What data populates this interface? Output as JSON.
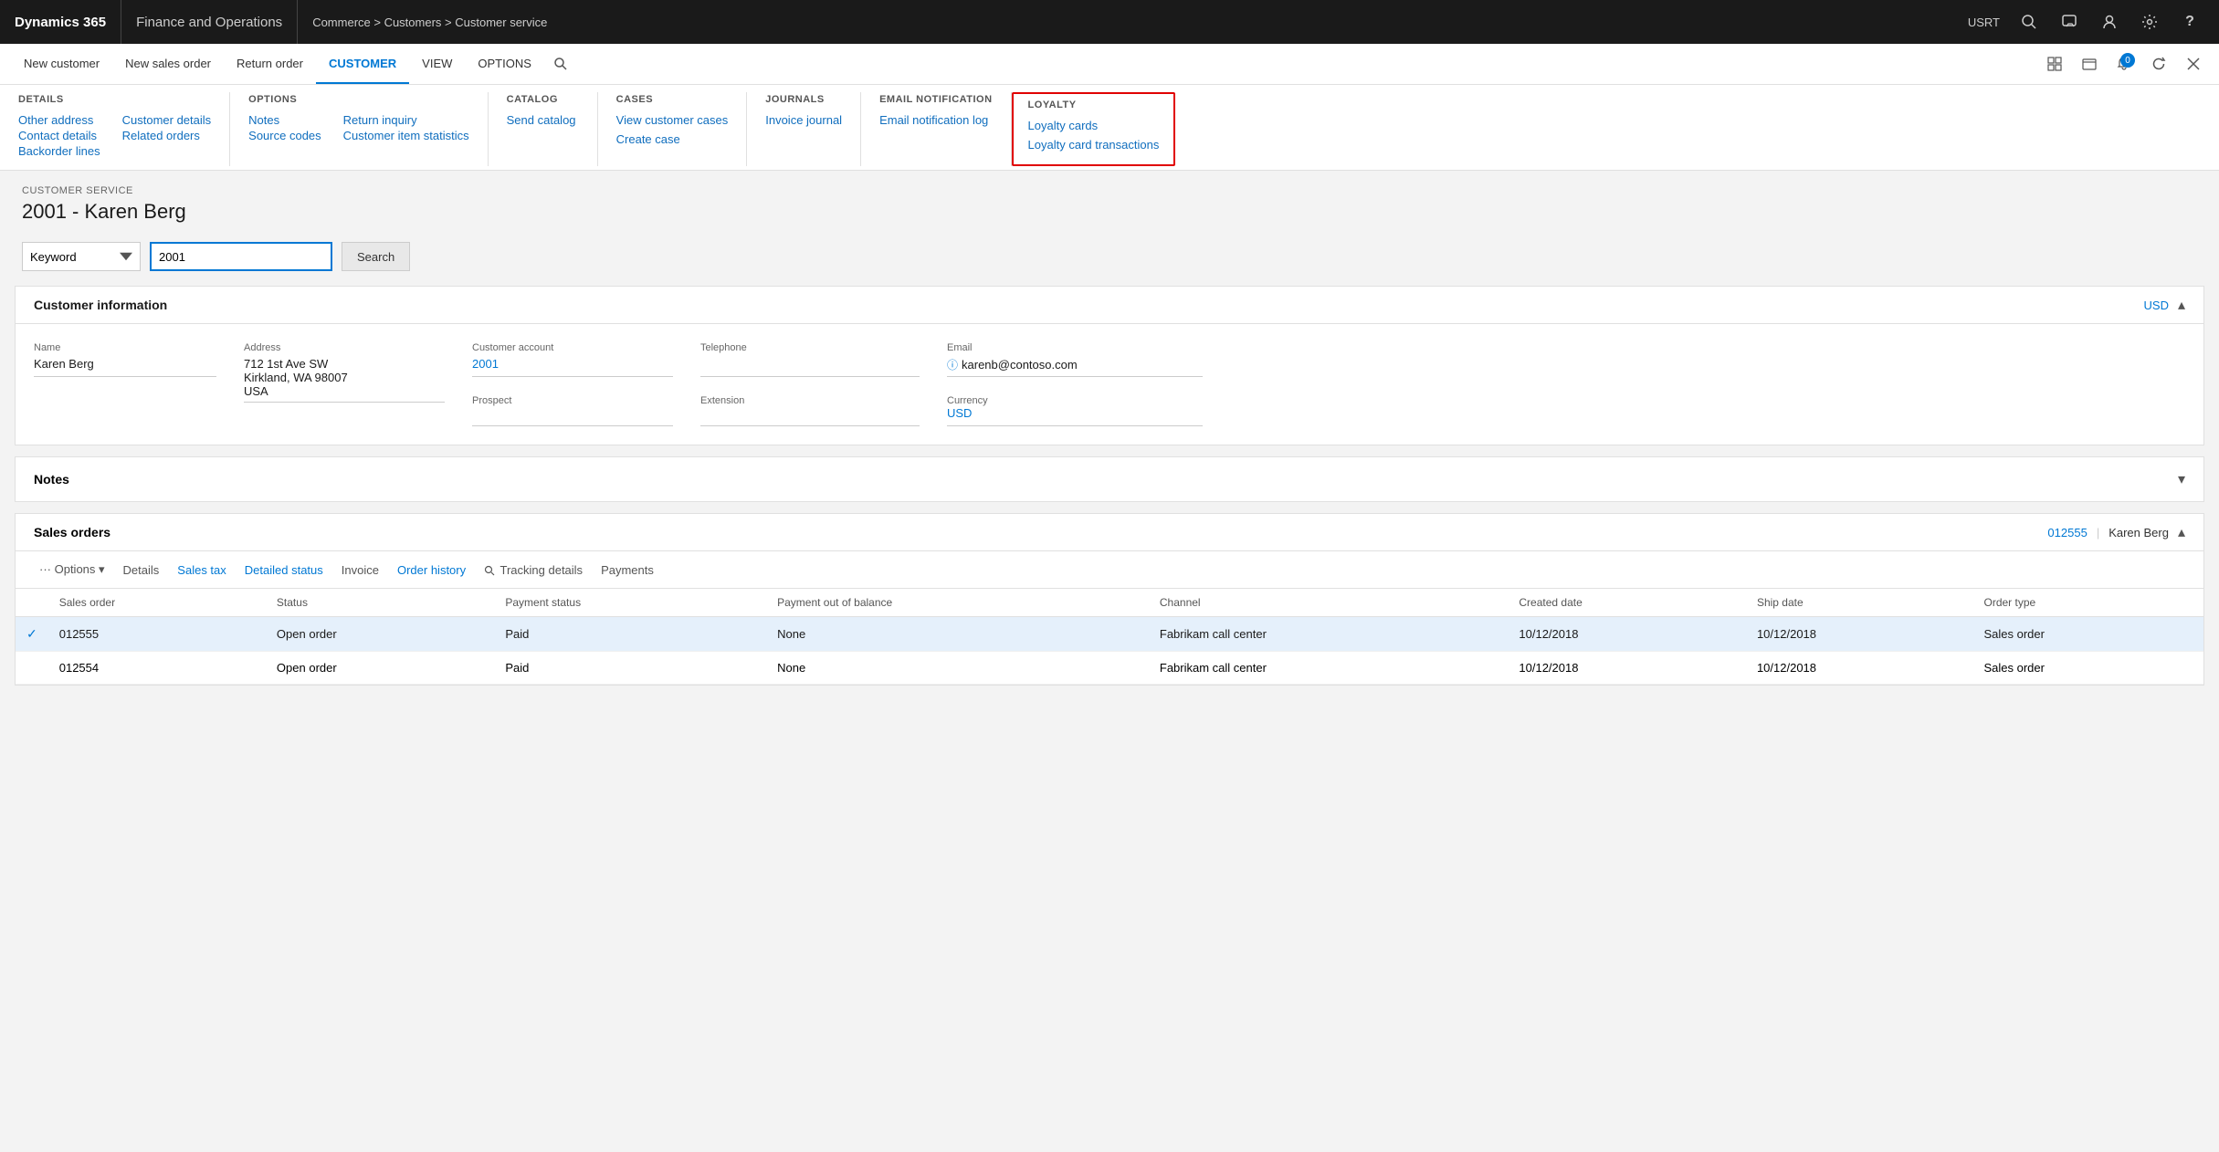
{
  "topnav": {
    "brand_d365": "Dynamics 365",
    "brand_fo": "Finance and Operations",
    "breadcrumb": "Commerce > Customers > Customer service",
    "user": "USRT"
  },
  "ribbon_tabs": [
    {
      "id": "new-customer",
      "label": "New customer",
      "active": false
    },
    {
      "id": "new-sales-order",
      "label": "New sales order",
      "active": false
    },
    {
      "id": "return-order",
      "label": "Return order",
      "active": false
    },
    {
      "id": "customer",
      "label": "CUSTOMER",
      "active": true
    },
    {
      "id": "view",
      "label": "VIEW",
      "active": false
    },
    {
      "id": "options",
      "label": "OPTIONS",
      "active": false
    }
  ],
  "ribbon_menu": {
    "sections": [
      {
        "id": "details",
        "title": "DETAILS",
        "items": [
          {
            "label": "Other address"
          },
          {
            "label": "Contact details"
          },
          {
            "label": "Backorder lines"
          }
        ],
        "cols": [
          [
            {
              "label": "Other address"
            },
            {
              "label": "Contact details"
            },
            {
              "label": "Backorder lines"
            }
          ],
          [
            {
              "label": "Customer details"
            },
            {
              "label": "Related orders"
            }
          ]
        ]
      },
      {
        "id": "options",
        "title": "OPTIONS",
        "cols": [
          [
            {
              "label": "Notes"
            },
            {
              "label": "Source codes"
            }
          ],
          [
            {
              "label": "Return inquiry"
            },
            {
              "label": "Customer item statistics"
            }
          ]
        ]
      },
      {
        "id": "catalog",
        "title": "CATALOG",
        "items": [
          {
            "label": "Send catalog"
          }
        ]
      },
      {
        "id": "cases",
        "title": "CASES",
        "items": [
          {
            "label": "View customer cases"
          },
          {
            "label": "Create case"
          }
        ]
      },
      {
        "id": "journals",
        "title": "JOURNALS",
        "items": [
          {
            "label": "Invoice journal"
          }
        ]
      },
      {
        "id": "email-notification",
        "title": "EMAIL NOTIFICATION",
        "items": [
          {
            "label": "Email notification log"
          }
        ]
      },
      {
        "id": "loyalty",
        "title": "LOYALTY",
        "highlighted": true,
        "items": [
          {
            "label": "Loyalty cards"
          },
          {
            "label": "Loyalty card transactions"
          }
        ]
      }
    ]
  },
  "page": {
    "service_label": "CUSTOMER SERVICE",
    "title": "2001 - Karen Berg"
  },
  "search": {
    "keyword_label": "Keyword",
    "input_value": "2001",
    "button_label": "Search"
  },
  "customer_info": {
    "section_title": "Customer information",
    "currency_link": "USD",
    "fields": {
      "name_label": "Name",
      "name_value": "Karen Berg",
      "address_label": "Address",
      "address_line1": "712 1st Ave SW",
      "address_line2": "Kirkland, WA 98007",
      "address_line3": "USA",
      "account_label": "Customer account",
      "account_value": "2001",
      "telephone_label": "Telephone",
      "telephone_value": "",
      "email_label": "Email",
      "email_value": "karenb@contoso.com",
      "prospect_label": "Prospect",
      "prospect_value": "",
      "extension_label": "Extension",
      "extension_value": "",
      "currency_label": "Currency",
      "currency_value": "USD"
    }
  },
  "notes": {
    "title": "Notes"
  },
  "sales_orders": {
    "title": "Sales orders",
    "header_link": "012555",
    "header_name": "Karen Berg",
    "toolbar": [
      {
        "label": "··· Options",
        "has_chevron": true,
        "link": false
      },
      {
        "label": "Details",
        "link": false
      },
      {
        "label": "Sales tax",
        "link": true
      },
      {
        "label": "Detailed status",
        "link": true
      },
      {
        "label": "Invoice",
        "link": false
      },
      {
        "label": "Order history",
        "link": true
      },
      {
        "label": "🔍 Tracking details",
        "link": false
      },
      {
        "label": "Payments",
        "link": false
      }
    ],
    "columns": [
      {
        "key": "check",
        "label": ""
      },
      {
        "key": "sales_order",
        "label": "Sales order"
      },
      {
        "key": "status",
        "label": "Status"
      },
      {
        "key": "payment_status",
        "label": "Payment status"
      },
      {
        "key": "payment_out_of_balance",
        "label": "Payment out of balance"
      },
      {
        "key": "channel",
        "label": "Channel"
      },
      {
        "key": "created_date",
        "label": "Created date"
      },
      {
        "key": "ship_date",
        "label": "Ship date"
      },
      {
        "key": "order_type",
        "label": "Order type"
      }
    ],
    "rows": [
      {
        "selected": true,
        "check": "✓",
        "sales_order": "012555",
        "status": "Open order",
        "payment_status": "Paid",
        "payment_out_of_balance": "None",
        "channel": "Fabrikam call center",
        "created_date": "10/12/2018",
        "ship_date": "10/12/2018",
        "order_type": "Sales order"
      },
      {
        "selected": false,
        "check": "",
        "sales_order": "012554",
        "status": "Open order",
        "payment_status": "Paid",
        "payment_out_of_balance": "None",
        "channel": "Fabrikam call center",
        "created_date": "10/12/2018",
        "ship_date": "10/12/2018",
        "order_type": "Sales order"
      }
    ]
  },
  "icons": {
    "search": "🔍",
    "chevron_down": "▾",
    "chevron_up": "▴",
    "gear": "⚙",
    "person": "👤",
    "bell": "🔔",
    "refresh": "↺",
    "close": "✕",
    "settings": "⚙",
    "help": "?",
    "grid": "⊞",
    "info": "ⓘ"
  }
}
